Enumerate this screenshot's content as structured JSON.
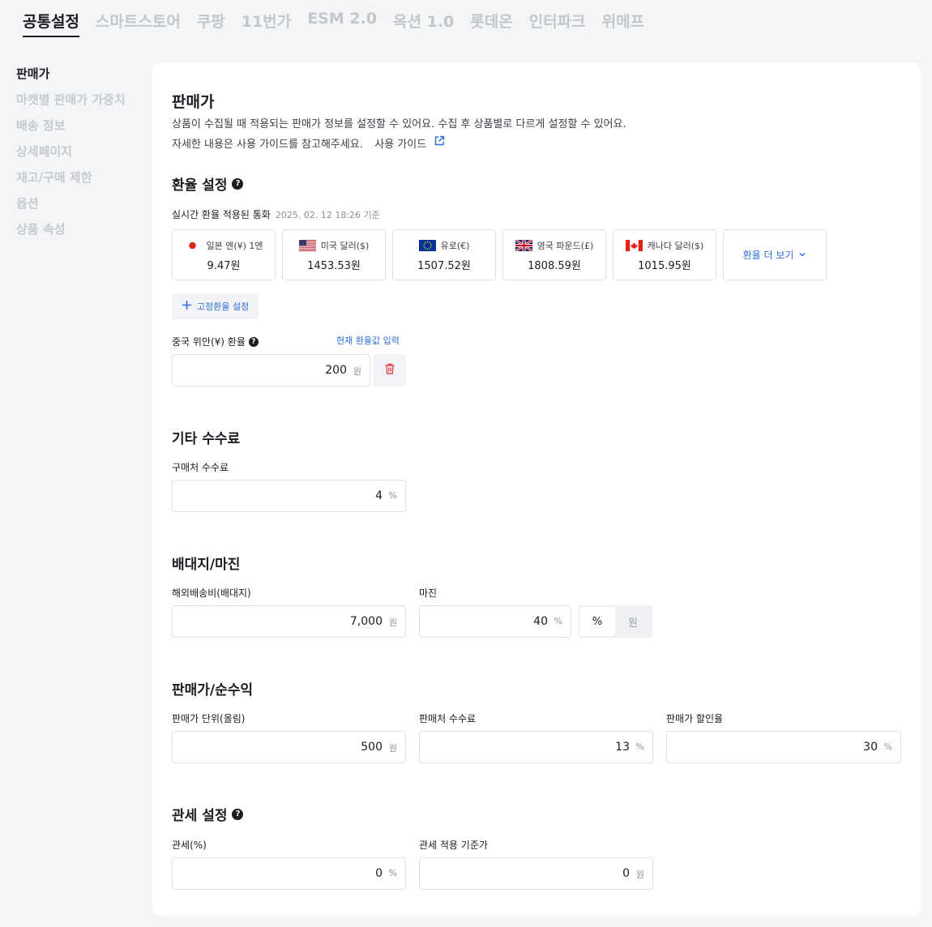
{
  "top_tabs": [
    "공통설정",
    "스마트스토어",
    "쿠팡",
    "11번가",
    "ESM 2.0",
    "옥션 1.0",
    "롯데온",
    "인터파크",
    "위메프"
  ],
  "side_nav": [
    "판매가",
    "마켓별 판매가 가중치",
    "배송 정보",
    "상세페이지",
    "재고/구매 제한",
    "옵션",
    "상품 속성"
  ],
  "header": {
    "title": "판매가",
    "desc_line1": "상품이 수집될 때 적용되는 판매가 정보를 설정할 수 있어요. 수집 후 상품별로 다르게 설정할 수 있어요.",
    "desc_line2": "자세한 내용은 사용 가이드를 참고해주세요.",
    "guide_link": "사용 가이드"
  },
  "exchange": {
    "title": "환율 설정",
    "realtime_label": "실시간 환율 적용된 통화",
    "timestamp": "2025. 02. 12 18:26 기준",
    "currencies": [
      {
        "name": "일본 엔(¥) 1엔",
        "value": "9.47원",
        "flag": "japan-flag-icon"
      },
      {
        "name": "미국 달러($)",
        "value": "1453.53원",
        "flag": "usa-flag-icon"
      },
      {
        "name": "유로(€)",
        "value": "1507.52원",
        "flag": "eu-flag-icon"
      },
      {
        "name": "영국 파운드(£)",
        "value": "1808.59원",
        "flag": "uk-flag-icon"
      },
      {
        "name": "캐나다 달러($)",
        "value": "1015.95원",
        "flag": "canada-flag-icon"
      }
    ],
    "more_label": "환율 더 보기",
    "fixed_btn": "고정환율 설정",
    "cny_label": "중국 위안(¥) 환율",
    "current_rate_link": "현재 환율값 입력",
    "cny_value": "200",
    "cny_unit": "원"
  },
  "fees": {
    "title": "기타 수수료",
    "buy_fee_label": "구매처 수수료",
    "buy_fee_value": "4",
    "buy_fee_unit": "%"
  },
  "margin": {
    "title": "배대지/마진",
    "shipping_label": "해외배송비(배대지)",
    "shipping_value": "7,000",
    "shipping_unit": "원",
    "margin_label": "마진",
    "margin_value": "40",
    "margin_unit": "%",
    "toggle_percent": "%",
    "toggle_won": "원"
  },
  "price": {
    "title": "판매가/순수익",
    "unit_label": "판매가 단위(올림)",
    "unit_value": "500",
    "unit_unit": "원",
    "sell_fee_label": "판매처 수수료",
    "sell_fee_value": "13",
    "sell_fee_unit": "%",
    "discount_label": "판매가 할인율",
    "discount_value": "30",
    "discount_unit": "%"
  },
  "customs": {
    "title": "관세 설정",
    "rate_label": "관세(%)",
    "rate_value": "0",
    "rate_unit": "%",
    "base_label": "관세 적용 기준가",
    "base_value": "0",
    "base_unit": "원"
  },
  "colors": {
    "accent": "#2f6fd6",
    "danger": "#e5484d",
    "background": "#f4f5f7"
  }
}
